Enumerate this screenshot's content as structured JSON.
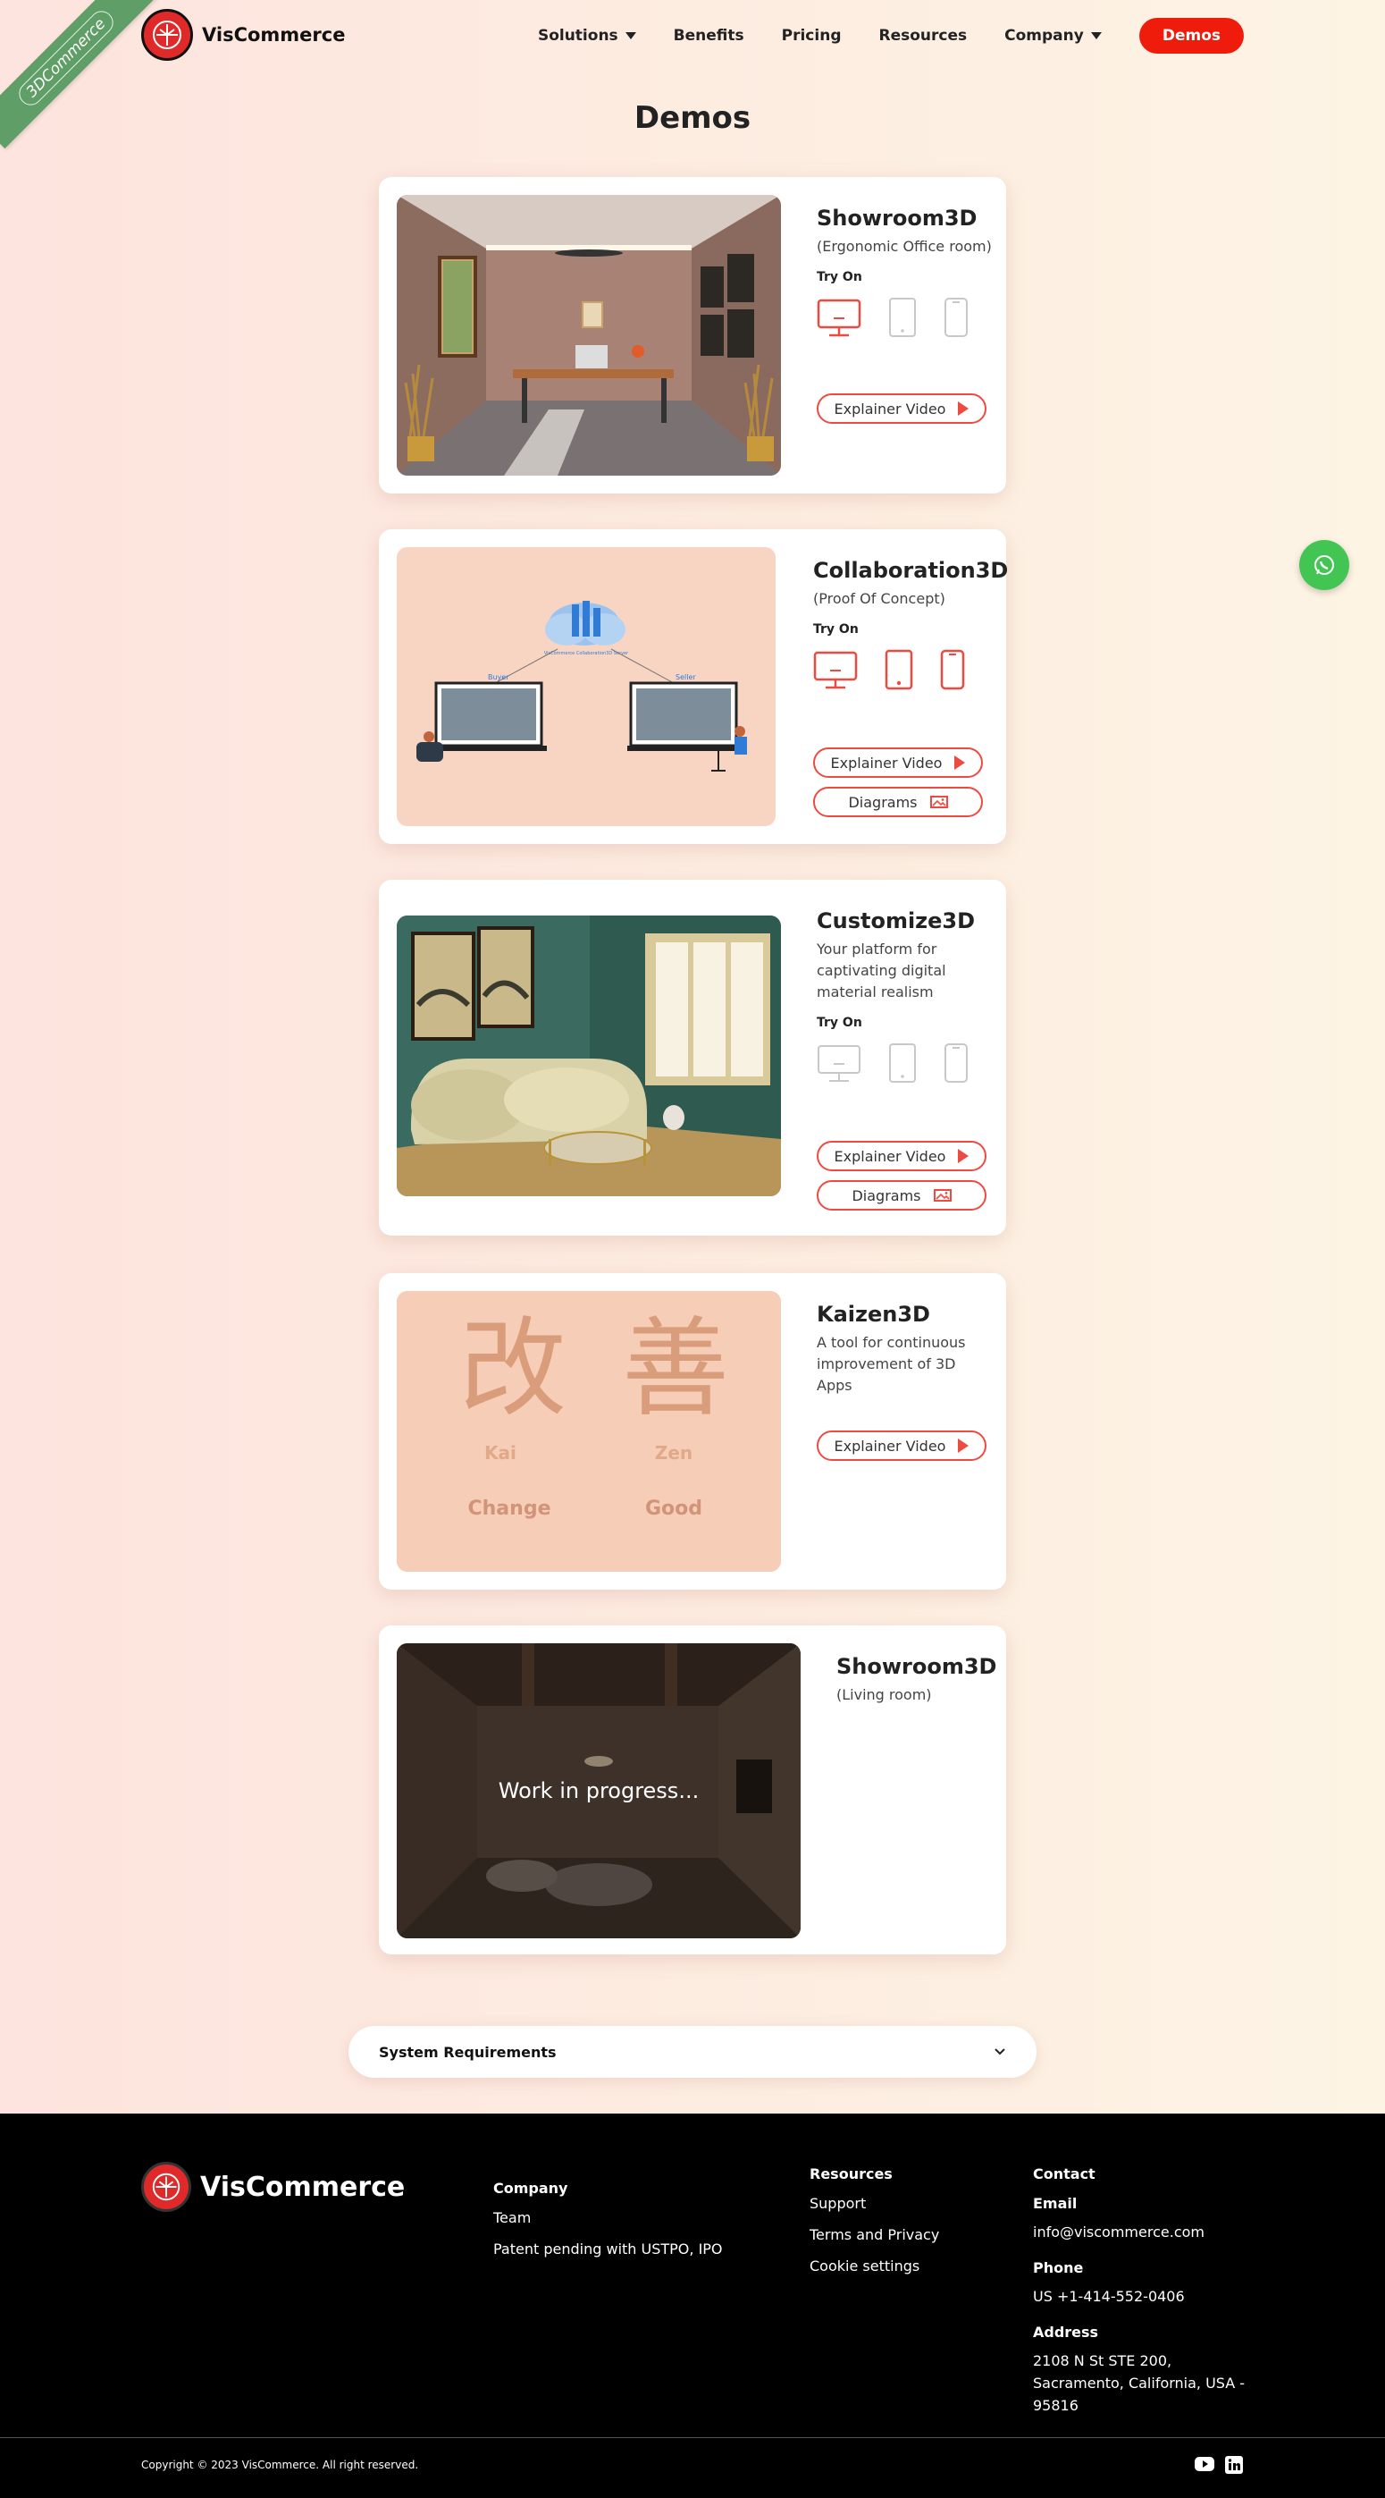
{
  "ribbon": {
    "text": "3DCommerce"
  },
  "header": {
    "brand": "VisCommerce",
    "nav": [
      {
        "label": "Solutions",
        "dropdown": true
      },
      {
        "label": "Benefits",
        "dropdown": false
      },
      {
        "label": "Pricing",
        "dropdown": false
      },
      {
        "label": "Resources",
        "dropdown": false
      },
      {
        "label": "Company",
        "dropdown": true
      }
    ],
    "cta": "Demos"
  },
  "page_title": "Demos",
  "cards": [
    {
      "title": "Showroom3D",
      "subtitle": "(Ergonomic Office room)",
      "try_on": "Try On",
      "buttons": [
        "Explainer Video"
      ]
    },
    {
      "title": "Collaboration3D",
      "subtitle": "(Proof Of Concept)",
      "try_on": "Try On",
      "buttons": [
        "Explainer Video",
        "Diagrams"
      ],
      "diagram": {
        "server": "VisCommerce Collaboration3D Server",
        "left": "Buyer",
        "right": "Seller"
      }
    },
    {
      "title": "Customize3D",
      "subtitle": "Your platform for captivating digital material realism",
      "try_on": "Try On",
      "buttons": [
        "Explainer Video",
        "Diagrams"
      ]
    },
    {
      "title": "Kaizen3D",
      "subtitle": "A tool for continuous improvement of 3D Apps",
      "buttons": [
        "Explainer Video"
      ],
      "kaizen": {
        "char1": "改",
        "roman1": "Kai",
        "meaning1": "Change",
        "char2": "善",
        "roman2": "Zen",
        "meaning2": "Good"
      }
    },
    {
      "title": "Showroom3D",
      "subtitle": "(Living room)",
      "overlay": "Work in progress..."
    }
  ],
  "system_requirements": "System Requirements",
  "footer": {
    "brand": "VisCommerce",
    "company": {
      "heading": "Company",
      "links": [
        "Team",
        "Patent pending with USTPO, IPO"
      ]
    },
    "resources": {
      "heading": "Resources",
      "links": [
        "Support",
        "Terms and Privacy",
        "Cookie settings"
      ]
    },
    "contact": {
      "heading": "Contact",
      "email_label": "Email",
      "email": "info@viscommerce.com",
      "phone_label": "Phone",
      "phone": "US +1-414-552-0406",
      "address_label": "Address",
      "address": "2108 N St STE 200, Sacramento, California, USA - 95816"
    },
    "copyright": "Copyright © 2023 VisCommerce. All right reserved."
  },
  "colors": {
    "accent": "#ef1c0b",
    "outline": "#ef4a40",
    "ribbon": "#5f9e67",
    "whatsapp": "#43c553"
  }
}
